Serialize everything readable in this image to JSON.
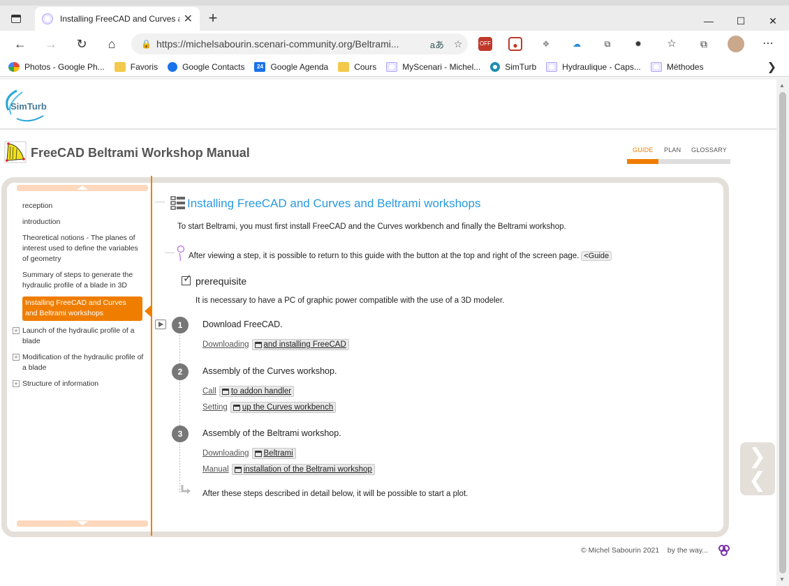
{
  "browser": {
    "tab_title": "Installing FreeCAD and Curves ar",
    "url": "https://michelsabourin.scenari-community.org/Beltrami...",
    "read_aloud": "aあ",
    "bookmarks": [
      {
        "label": "Photos - Google Ph...",
        "icon": "pinwheel-icon"
      },
      {
        "label": "Favoris",
        "icon": "folder-icon"
      },
      {
        "label": "Google Contacts",
        "icon": "contacts-icon"
      },
      {
        "label": "Google Agenda",
        "icon": "calendar-icon",
        "badge": "24"
      },
      {
        "label": "Cours",
        "icon": "folder-icon"
      },
      {
        "label": "MyScenari - Michel...",
        "icon": "scenari-icon"
      },
      {
        "label": "SimTurb",
        "icon": "simturb-icon"
      },
      {
        "label": "Hydraulique - Caps...",
        "icon": "scenari-icon"
      },
      {
        "label": "Méthodes",
        "icon": "scenari-icon"
      }
    ]
  },
  "site": {
    "logo_text": "SimTurb",
    "manual_title": "FreeCAD Beltrami Workshop Manual",
    "topnav": [
      "GUIDE",
      "PLAN",
      "GLOSSARY"
    ]
  },
  "sidebar": {
    "items": [
      {
        "label": "reception"
      },
      {
        "label": "introduction"
      },
      {
        "label": "Theoretical notions - The planes of interest used to define the variables of geometry"
      },
      {
        "label": "Summary of steps to generate the hydraulic profile of a blade in 3D"
      },
      {
        "label": "Installing FreeCAD and Curves and Beltrami workshops"
      },
      {
        "label": "Launch of the hydraulic profile of a blade"
      },
      {
        "label": "Modification of the hydraulic profile of a blade"
      },
      {
        "label": "Structure of information"
      }
    ]
  },
  "content": {
    "title": "Installing FreeCAD and Curves and Beltrami workshops",
    "intro": "To start Beltrami, you must first install FreeCAD and the Curves workbench and finally the Beltrami workshop.",
    "tip": "After viewing a step, it is possible to return to this guide with the button at the top and right of the screen page.",
    "tip_button": "<Guide",
    "prereq_title": "prerequisite",
    "prereq_text": "It is necessary to have a PC of graphic power compatible with the use of a 3D modeler.",
    "steps": [
      {
        "num": "1",
        "title": "Download FreeCAD.",
        "links": [
          {
            "pre": "Downloading",
            "btn": "and installing FreeCAD"
          }
        ]
      },
      {
        "num": "2",
        "title": "Assembly of the Curves workshop.",
        "links": [
          {
            "pre": "Call",
            "btn": "to addon handler"
          },
          {
            "pre": "Setting",
            "btn": "up the Curves workbench"
          }
        ]
      },
      {
        "num": "3",
        "title": "Assembly of the Beltrami workshop.",
        "links": [
          {
            "pre": "Downloading",
            "btn": "Beltrami"
          },
          {
            "pre": "Manual",
            "btn": "installation of the Beltrami workshop"
          }
        ]
      }
    ],
    "outro": "After these steps described in detail below, it will be possible to start a plot."
  },
  "footer": {
    "copyright": "© Michel Sabourin 2021",
    "by_the_way": "by the way..."
  },
  "colors": {
    "accent": "#ef7d00",
    "title_blue": "#2899dd",
    "frame": "#e4dfd9"
  }
}
